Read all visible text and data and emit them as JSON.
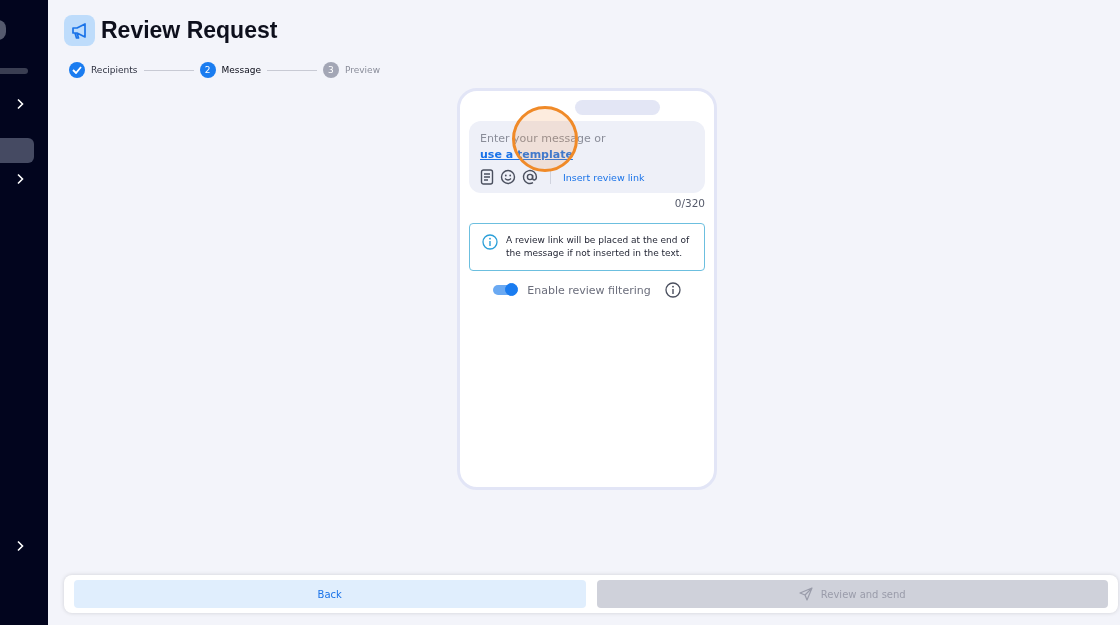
{
  "sidebar": {
    "items": [
      {
        "selected": false,
        "expandable": true
      },
      {
        "selected": true,
        "expandable": false
      },
      {
        "selected": false,
        "expandable": true
      },
      {
        "selected": false,
        "expandable": true
      }
    ]
  },
  "page": {
    "title": "Review Request"
  },
  "steps": [
    {
      "label": "Recipients",
      "completed": true,
      "selected": false
    },
    {
      "label": "Message",
      "number": "2",
      "completed": false,
      "selected": true
    },
    {
      "label": "Preview",
      "number": "3",
      "completed": false,
      "selected": false
    }
  ],
  "message": {
    "placeholder": "Enter your message or ",
    "template_link": "use a template",
    "insert_link": "Insert review link",
    "counter": "0/320"
  },
  "notice": {
    "text": "A review link will be placed at the end of the message if not inserted in the text."
  },
  "filter_toggle": {
    "label": "Enable review filtering",
    "on": true
  },
  "footer": {
    "buttons": [
      {
        "label": "Back",
        "kind": "secondary",
        "disabled": false
      },
      {
        "label": "Review and send",
        "kind": "send",
        "disabled": true
      }
    ]
  }
}
